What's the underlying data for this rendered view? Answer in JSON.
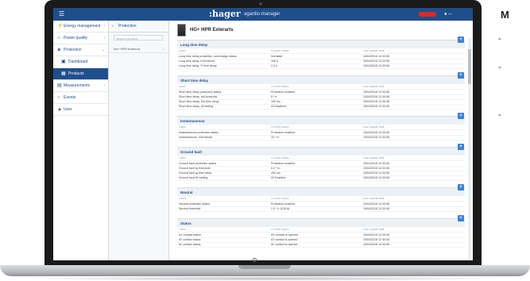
{
  "topbar": {
    "menu_icon": "menu-icon",
    "brand": ":hager",
    "brand_sub": "agardio.manager",
    "user": "☰"
  },
  "sidebar": {
    "items": [
      {
        "icon": "bolt-icon",
        "glyph": "⚡",
        "label": "Energy management",
        "chev": "›"
      },
      {
        "icon": "quality-icon",
        "glyph": "⌂",
        "label": "Power quality",
        "chev": "›"
      },
      {
        "icon": "shield-icon",
        "glyph": "◈",
        "label": "Protection",
        "chev": "⌄"
      },
      {
        "icon": "dashboard-icon",
        "glyph": "▣",
        "label": "Dashboard",
        "chev": ""
      },
      {
        "icon": "products-icon",
        "glyph": "▦",
        "label": "Products",
        "chev": ""
      },
      {
        "icon": "measure-icon",
        "glyph": "▤",
        "label": "Measurements",
        "chev": "›"
      },
      {
        "icon": "events-icon",
        "glyph": "○",
        "label": "Events",
        "chev": ""
      },
      {
        "icon": "user-icon",
        "glyph": "▲",
        "label": "User",
        "chev": ""
      }
    ]
  },
  "subcol": {
    "head": "Protection",
    "search_placeholder": "Search product",
    "item": "hw+ HPR Antenna",
    "chev": "›"
  },
  "device": {
    "title": "HG+ HPR Exterarts"
  },
  "columns": [
    "Label",
    "Current status",
    "Last update date"
  ],
  "sections": [
    {
      "title": "Long time delay",
      "rows": [
        [
          "Long time delay protection, overcharge status",
          "Not state",
          "15/04/2018 12:33:08"
        ],
        [
          "Long time delay, Ir threshold",
          "100 A",
          "15/04/2018 12:33:08"
        ],
        [
          "Long time delay, Tr time delay",
          "2.5 s",
          "15/04/2018 12:33:08"
        ]
      ]
    },
    {
      "title": "Short time delay",
      "rows": [
        [
          "Short time delay protection status",
          "Protection enabled",
          "15/04/2018 12:33:08"
        ],
        [
          "Short time delay, Isd threshold",
          "5 * Ir",
          "15/04/2018 12:33:08"
        ],
        [
          "Short time delay, Tsd time delay",
          "100 ms",
          "15/04/2018 12:33:08"
        ],
        [
          "Short time delay, I2t setting",
          "I2t Disabled",
          "15/04/2018 12:33:08"
        ]
      ]
    },
    {
      "title": "Instantaneous",
      "rows": [
        [
          "Instantaneous protection status",
          "Protection enabled",
          "15/04/2018 12:33:08"
        ],
        [
          "Instantaneous, Ii threshold",
          "10 * In",
          "15/04/2018 12:33:08"
        ]
      ]
    },
    {
      "title": "Ground fault",
      "rows": [
        [
          "Ground fault protection status",
          "Protection enabled",
          "15/04/2018 12:33:08"
        ],
        [
          "Ground fault Ig threshold",
          "0.2 * In",
          "15/04/2018 12:33:08"
        ],
        [
          "Ground fault tg time delay",
          "200 ms",
          "15/04/2018 12:33:08"
        ],
        [
          "Ground fault I2t setting",
          "I2t Enabled",
          "15/04/2018 12:33:08"
        ]
      ]
    },
    {
      "title": "Neutral",
      "rows": [
        [
          "Neutral protection status",
          "Protection enabled",
          "15/04/2018 12:33:08"
        ],
        [
          "Neutral threshold",
          "1.0 * Ir (100 A)",
          "15/04/2018 12:33:08"
        ]
      ]
    },
    {
      "title": "Status",
      "rows": [
        [
          "AX contact status",
          "AX contact is opened",
          "15/04/2018 12:33:08"
        ],
        [
          "AT contact status",
          "AT contact is opened",
          "15/04/2018 12:33:08"
        ],
        [
          "AL contact status",
          "AL contact is opened",
          "15/04/2018 12:33:08"
        ]
      ]
    }
  ],
  "section_button_glyph": "+",
  "side_heading": "M",
  "side_dashes": [
    "-",
    "-",
    "-"
  ]
}
